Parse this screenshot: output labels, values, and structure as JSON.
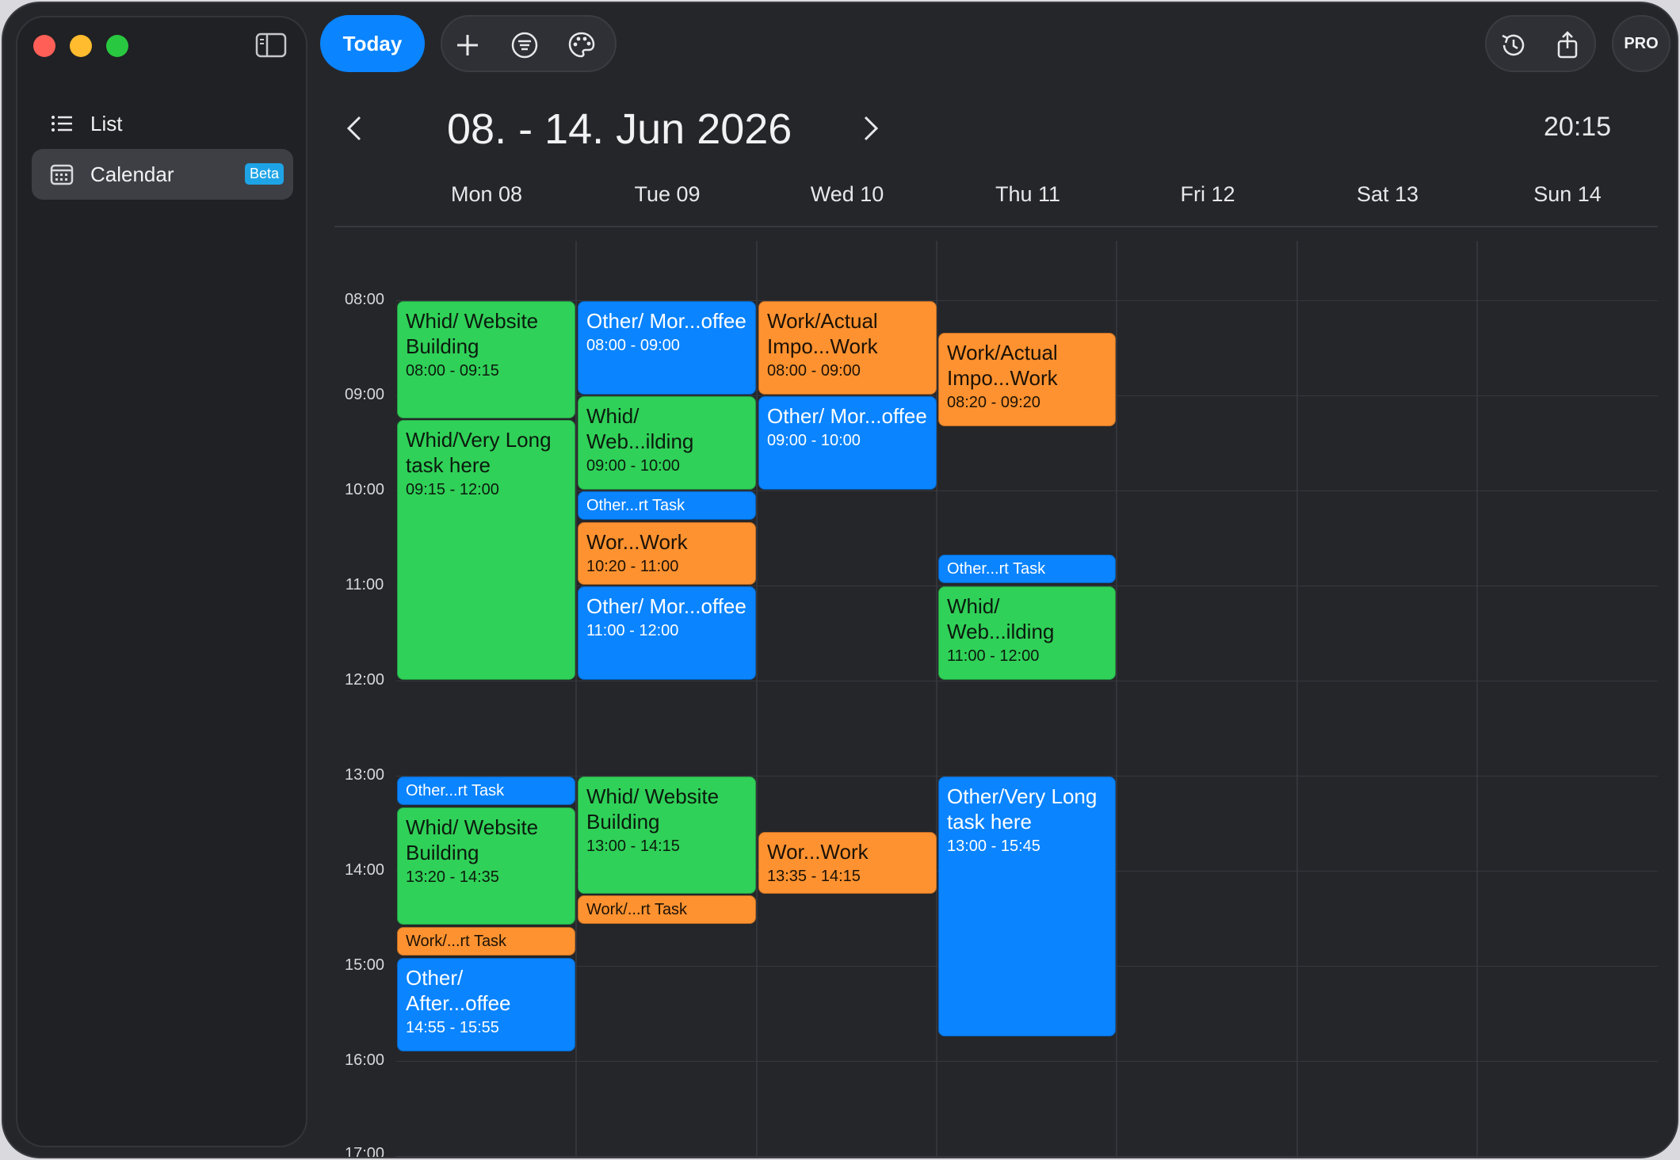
{
  "sidebar": {
    "items": [
      {
        "label": "List",
        "icon": "list-icon"
      },
      {
        "label": "Calendar",
        "icon": "calendar-icon",
        "badge": "Beta"
      }
    ]
  },
  "toolbar": {
    "today_label": "Today",
    "pro_label": "PRO",
    "icons": [
      "plus-icon",
      "filter-icon",
      "palette-icon",
      "history-icon",
      "share-icon"
    ]
  },
  "header": {
    "range": "08. - 14. Jun 2026",
    "time": "20:15",
    "days": [
      "Mon 08",
      "Tue 09",
      "Wed 10",
      "Thu 11",
      "Fri 12",
      "Sat 13",
      "Sun 14"
    ]
  },
  "hours": [
    "08:00",
    "09:00",
    "10:00",
    "11:00",
    "12:00",
    "13:00",
    "14:00",
    "15:00",
    "16:00",
    "17:00"
  ],
  "colors": {
    "green": "#30d158",
    "blue": "#0a84ff",
    "orange": "#ff9230"
  },
  "events": [
    {
      "day": "Mon 08",
      "title": "Whid/ Website Building",
      "time": "08:00 - 09:15",
      "color": "green"
    },
    {
      "day": "Mon 08",
      "title": "Whid/Very Long task here",
      "time": "09:15 - 12:00",
      "color": "green"
    },
    {
      "day": "Mon 08",
      "title": "Other...rt Task",
      "color": "blue"
    },
    {
      "day": "Mon 08",
      "title": "Whid/ Website Building",
      "time": "13:20 - 14:35",
      "color": "green"
    },
    {
      "day": "Mon 08",
      "title": "Work/...rt Task",
      "color": "orange"
    },
    {
      "day": "Mon 08",
      "title": "Other/ After...offee",
      "time": "14:55 - 15:55",
      "color": "blue"
    },
    {
      "day": "Tue 09",
      "title": "Other/ Mor...offee",
      "time": "08:00 - 09:00",
      "color": "blue"
    },
    {
      "day": "Tue 09",
      "title": "Whid/ Web...ilding",
      "time": "09:00 - 10:00",
      "color": "green"
    },
    {
      "day": "Tue 09",
      "title": "Other...rt Task",
      "color": "blue"
    },
    {
      "day": "Tue 09",
      "title": "Wor...Work",
      "time": "10:20 - 11:00",
      "color": "orange"
    },
    {
      "day": "Tue 09",
      "title": "Other/ Mor...offee",
      "time": "11:00 - 12:00",
      "color": "blue"
    },
    {
      "day": "Tue 09",
      "title": "Whid/ Website Building",
      "time": "13:00 - 14:15",
      "color": "green"
    },
    {
      "day": "Tue 09",
      "title": "Work/...rt Task",
      "color": "orange"
    },
    {
      "day": "Wed 10",
      "title": "Work/Actual Impo...Work",
      "time": "08:00 - 09:00",
      "color": "orange"
    },
    {
      "day": "Wed 10",
      "title": "Other/ Mor...offee",
      "time": "09:00 - 10:00",
      "color": "blue"
    },
    {
      "day": "Wed 10",
      "title": "Wor...Work",
      "time": "13:35 - 14:15",
      "color": "orange"
    },
    {
      "day": "Thu 11",
      "title": "Work/Actual Impo...Work",
      "time": "08:20 - 09:20",
      "color": "orange"
    },
    {
      "day": "Thu 11",
      "title": "Other...rt Task",
      "color": "blue"
    },
    {
      "day": "Thu 11",
      "title": "Whid/ Web...ilding",
      "time": "11:00 - 12:00",
      "color": "green"
    },
    {
      "day": "Thu 11",
      "title": "Other/Very Long task here",
      "time": "13:00 - 15:45",
      "color": "blue"
    }
  ]
}
